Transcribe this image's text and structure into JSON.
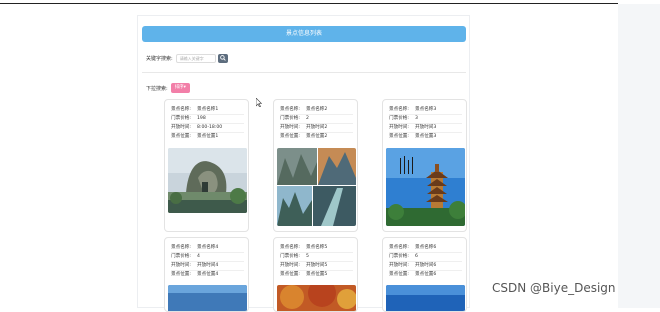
{
  "header": {
    "title": "景点信息列表"
  },
  "search": {
    "label": "关键字搜索:",
    "placeholder": "请输入关键字"
  },
  "sort": {
    "label": "下拉搜索:",
    "button": "排序▾"
  },
  "cards": [
    {
      "name": "景点名称1",
      "price": "198",
      "hours": "8:00-18:00",
      "location": "景点位置1"
    },
    {
      "name": "景点名称2",
      "price": "2",
      "hours": "开放时间2",
      "location": "景点位置2"
    },
    {
      "name": "景点名称3",
      "price": "3",
      "hours": "开放时间3",
      "location": "景点位置3"
    },
    {
      "name": "景点名称4",
      "price": "4",
      "hours": "开放时间4",
      "location": "景点位置4"
    },
    {
      "name": "景点名称5",
      "price": "5",
      "hours": "开放时间5",
      "location": "景点位置5"
    },
    {
      "name": "景点名称6",
      "price": "6",
      "hours": "开放时间6",
      "location": "景点位置6"
    }
  ],
  "fields": {
    "name": "景点名称:",
    "price": "门票价格:",
    "hours": "开放时间:",
    "location": "景点位置:"
  },
  "watermark": "CSDN @Biye_Design"
}
